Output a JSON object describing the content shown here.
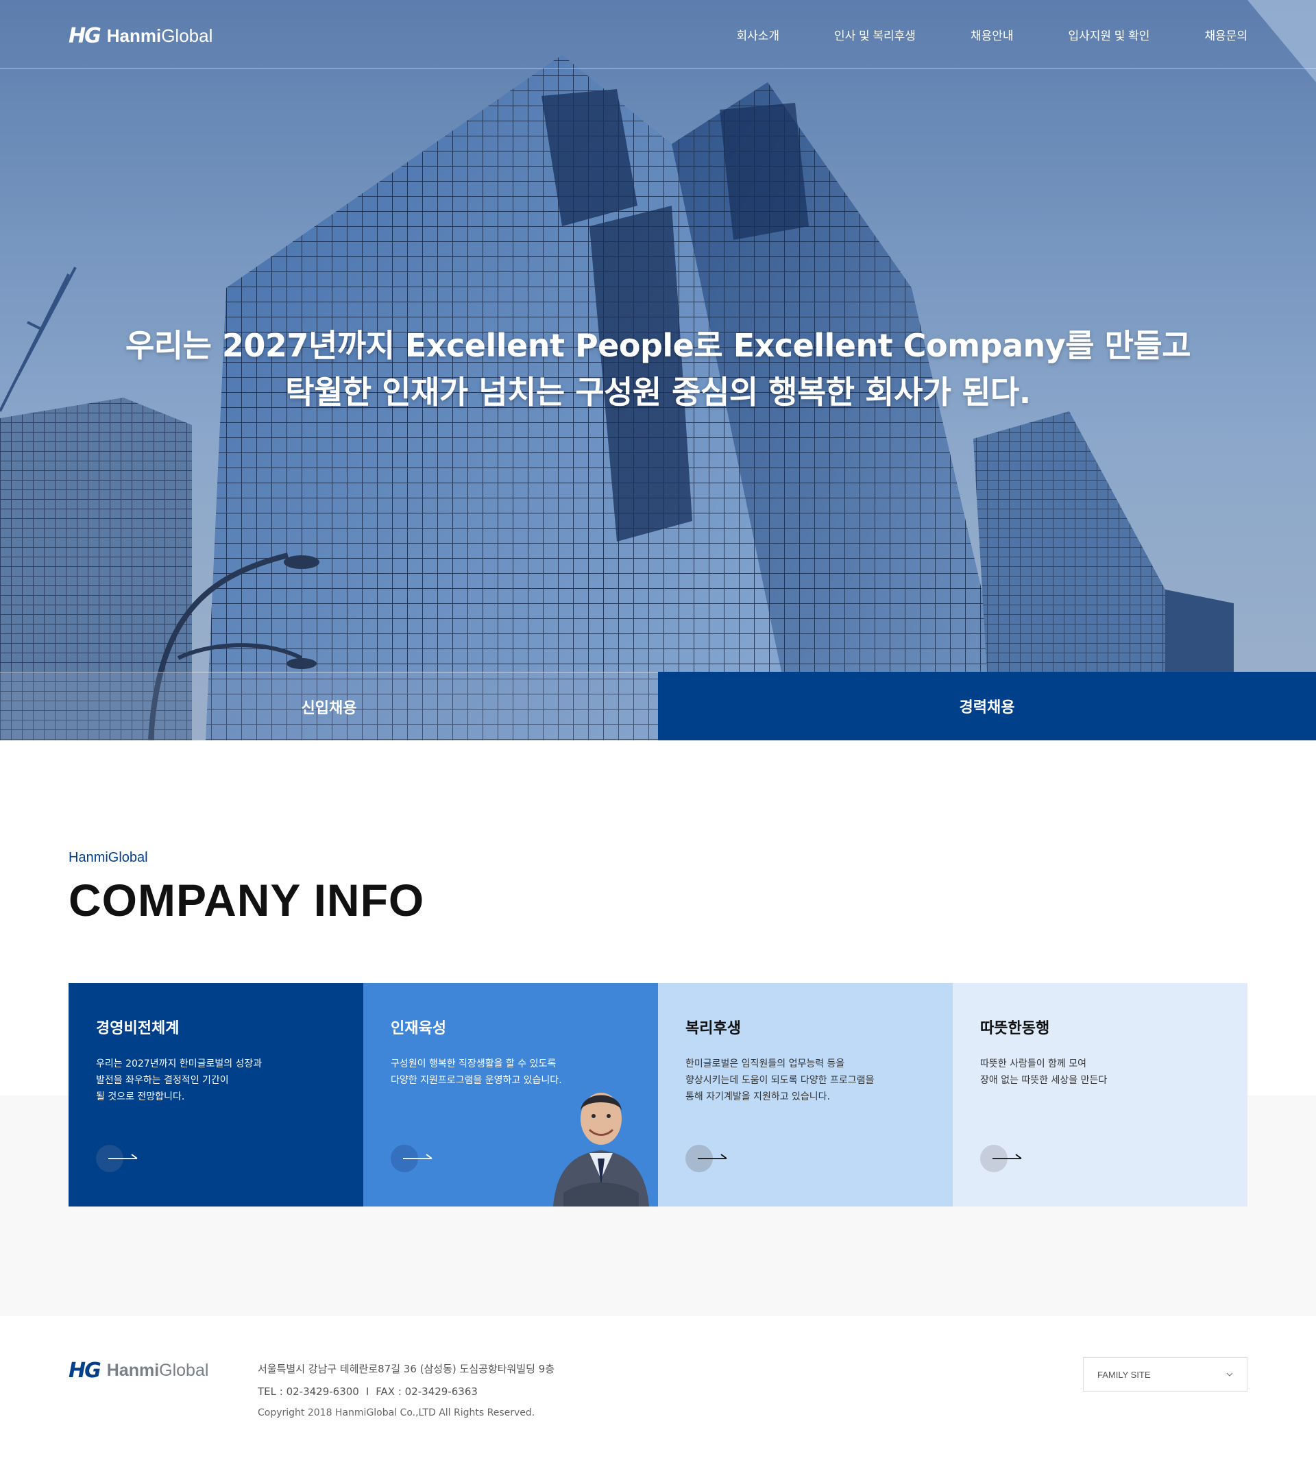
{
  "header": {
    "logo_mark": "HG",
    "logo_word_bold": "Hanmi",
    "logo_word_light": "Global",
    "nav": [
      "회사소개",
      "인사 및 복리후생",
      "채용안내",
      "입사지원 및 확인",
      "채용문의"
    ]
  },
  "hero": {
    "line1": "우리는 2027년까지 Excellent People로 Excellent Company를 만들고",
    "line2": "탁월한 인재가 넘치는 구성원 중심의 행복한 회사가 된다.",
    "tabs": {
      "new_hire": "신입채용",
      "experienced": "경력채용"
    }
  },
  "company": {
    "kicker": "HanmiGlobal",
    "title": "COMPANY INFO",
    "cards": [
      {
        "title": "경영비전체계",
        "text": "우리는 2027년까지 한미글로벌의 성장과\n발전을 좌우하는 결정적인 기간이\n될 것으로 전망합니다."
      },
      {
        "title": "인재육성",
        "text": "구성원이 행복한 직장생활을 할 수 있도록\n다양한 지원프로그램을 운영하고 있습니다."
      },
      {
        "title": "복리후생",
        "text": "한미글로벌은 임직원들의 업무능력 등을\n향상시키는데 도움이 되도록 다양한 프로그램을\n통해 자기계발을 지원하고 있습니다."
      },
      {
        "title": "따뜻한동행",
        "text": "따뜻한 사람들이 함께 모여\n장애 없는 따뜻한 세상을 만든다"
      }
    ]
  },
  "footer": {
    "logo_mark": "HG",
    "logo_word_bold": "Hanmi",
    "logo_word_light": "Global",
    "address": "서울특별시 강남구 테헤란로87길 36 (삼성동) 도심공항타워빌딩 9층",
    "tel": "TEL : 02-3429-6300",
    "separator": "I",
    "fax": "FAX : 02-3429-6363",
    "copyright": "Copyright 2018 HanmiGlobal Co.,LTD All Rights Reserved.",
    "family_site": "FAMILY SITE"
  },
  "colors": {
    "brand_navy": "#003f8a",
    "brand_blue": "#3f86d8",
    "light_blue": "#bedaf7",
    "pale_blue": "#e1ecfb"
  }
}
